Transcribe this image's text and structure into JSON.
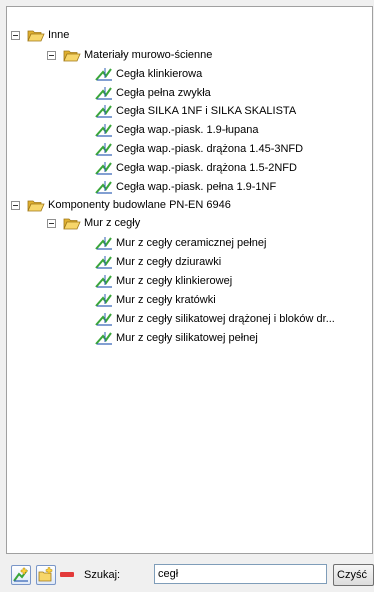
{
  "tree": {
    "root1": {
      "label": "Inne",
      "child": {
        "label": "Materiały murowo-ścienne",
        "items": [
          "Cegła klinkierowa",
          "Cegła pełna zwykła",
          "Cegła SILKA 1NF i SILKA SKALISTA",
          "Cegła wap.-piask. 1.9-łupana",
          "Cegła wap.-piask. drążona 1.45-3NFD",
          "Cegła wap.-piask. drążona 1.5-2NFD",
          "Cegła wap.-piask. pełna 1.9-1NF"
        ]
      }
    },
    "root2": {
      "label": "Komponenty budowlane PN-EN 6946",
      "child": {
        "label": "Mur z cegły",
        "items": [
          "Mur z cegły ceramicznej pełnej",
          "Mur z cegły dziurawki",
          "Mur z cegły klinkierowej",
          "Mur z cegły kratówki",
          "Mur z cegły silikatowej drążonej i bloków dr...",
          "Mur z cegły silikatowej pełnej"
        ]
      }
    }
  },
  "toolbar": {
    "search_label": "Szukaj:",
    "search_value": "cegł",
    "clear_label": "Czyść"
  },
  "icons": {
    "collapse": "minus-box-icon",
    "folder": "open-folder-icon",
    "item": "material-graph-icon",
    "add_item": "add-material-icon",
    "add_folder": "add-folder-icon",
    "remove": "remove-icon"
  },
  "colors": {
    "folder": "#f2c94c",
    "item_green": "#3aa63a",
    "item_blue": "#2f5fb3",
    "remove": "#e33a3a"
  }
}
